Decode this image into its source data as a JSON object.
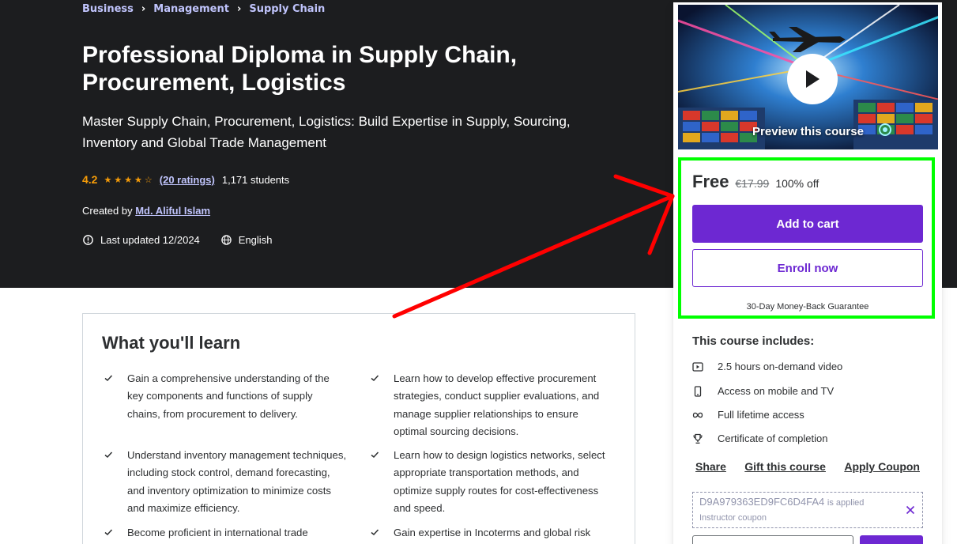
{
  "breadcrumbs": [
    "Business",
    "Management",
    "Supply Chain"
  ],
  "course": {
    "title": "Professional Diploma in Supply Chain, Procurement, Logistics",
    "subtitle": "Master Supply Chain, Procurement, Logistics: Build Expertise in Supply, Sourcing, Inventory and Global Trade Management",
    "rating": "4.2",
    "stars_filled": 4,
    "ratings_count": "(20 ratings)",
    "students": "1,171 students",
    "created_by_label": "Created by",
    "instructor": "Md. Aliful Islam",
    "last_updated": "Last updated 12/2024",
    "language": "English"
  },
  "learn": {
    "heading": "What you'll learn",
    "items": [
      "Gain a comprehensive understanding of the key components and functions of supply chains, from procurement to delivery.",
      "Learn how to develop effective procurement strategies, conduct supplier evaluations, and manage supplier relationships to ensure optimal sourcing decisions.",
      "Understand inventory management techniques, including stock control, demand forecasting, and inventory optimization to minimize costs and maximize efficiency.",
      "Learn how to design logistics networks, select appropriate transportation methods, and optimize supply routes for cost-effectiveness and speed.",
      "Become proficient in international trade",
      "Gain expertise in Incoterms and global risk"
    ]
  },
  "sidebar": {
    "preview_label": "Preview this course",
    "price_now": "Free",
    "price_old": "€17.99",
    "discount": "100% off",
    "add_to_cart": "Add to cart",
    "enroll_now": "Enroll now",
    "guarantee": "30-Day Money-Back Guarantee",
    "includes_title": "This course includes:",
    "includes": [
      {
        "icon": "video-icon",
        "text": "2.5 hours on-demand video"
      },
      {
        "icon": "mobile-icon",
        "text": "Access on mobile and TV"
      },
      {
        "icon": "infinity-icon",
        "text": "Full lifetime access"
      },
      {
        "icon": "trophy-icon",
        "text": "Certificate of completion"
      }
    ],
    "links": {
      "share": "Share",
      "gift": "Gift this course",
      "coupon": "Apply Coupon"
    },
    "coupon": {
      "code": "D9A979363ED9FC6D4FA4",
      "applied": "is applied",
      "sub": "Instructor coupon"
    }
  },
  "colors": {
    "hero_bg": "#1c1d1f",
    "link_purple": "#c0c4fc",
    "star_orange": "#f69c08",
    "brand_purple": "#6d28d2",
    "highlight_green": "#00ff00",
    "annotation_red": "#ff0000"
  }
}
